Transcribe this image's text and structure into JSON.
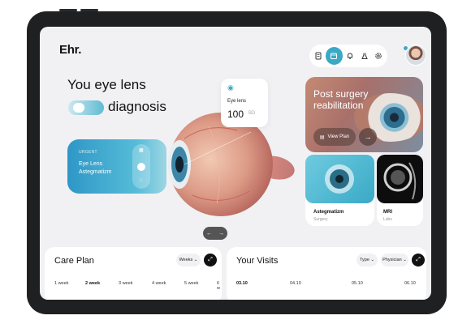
{
  "header": {
    "logo": "Ehr.",
    "icons": [
      "report-icon",
      "calendar-icon",
      "bell-icon",
      "flask-icon",
      "gear-icon"
    ]
  },
  "hero": {
    "line1": "You eye lens",
    "line2": "diagnosis"
  },
  "lens_card": {
    "label": "Eye lens",
    "value": "100",
    "unit": "BD"
  },
  "urgent_card": {
    "badge": "URGENT",
    "title": "Eye Lens Astegmatizm"
  },
  "post_card": {
    "title": "Post surgery reabilitation",
    "button": "View Plan"
  },
  "tiles": [
    {
      "title": "Astegmatizm",
      "subtitle": "Surgery"
    },
    {
      "title": "MRI",
      "subtitle": "Labs"
    }
  ],
  "care_plan": {
    "title": "Care Plan",
    "filter": "Weeks",
    "weeks": [
      "1 week",
      "2 week",
      "3 week",
      "4 week",
      "5 week",
      "6 w"
    ],
    "selected_week": "2 week"
  },
  "visits": {
    "title": "Your Visits",
    "filters": [
      "Type",
      "Physician"
    ],
    "dates": [
      "03.10",
      "04.10",
      "05.10",
      "06.10"
    ],
    "selected_date": "03.10"
  },
  "colors": {
    "accent": "#3aa9c6",
    "background": "#f1f1f4",
    "dark": "#111111"
  }
}
